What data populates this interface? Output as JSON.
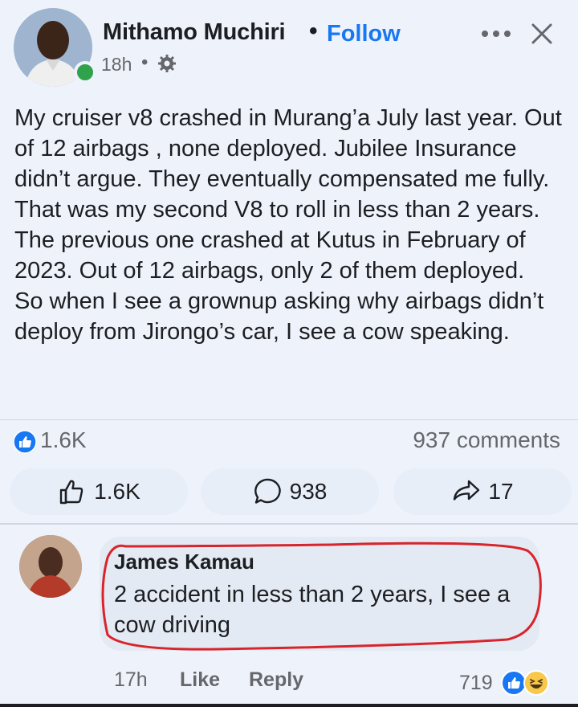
{
  "post": {
    "author": "Mithamo Muchiri",
    "separator": "•",
    "follow_label": "Follow",
    "time": "18h",
    "time_separator": "•",
    "text": "My cruiser v8 crashed in Murang’a July last year. Out of 12 airbags , none deployed. Jubilee Insurance didn’t argue. They eventually compensated me fully. That was my second V8 to roll in less than 2 years. The previous one crashed at Kutus in February of 2023. Out of 12 airbags, only 2 of them deployed.\nSo when I see a grownup asking why airbags didn’t deploy from Jirongo’s car, I see a cow speaking.",
    "reactions_count": "1.6K",
    "comments_summary": "937 comments"
  },
  "actions": {
    "like_count": "1.6K",
    "comment_count": "938",
    "share_count": "17"
  },
  "comment": {
    "author": "James Kamau",
    "text": "2 accident in less than 2 years, I see a cow driving",
    "time": "17h",
    "like_label": "Like",
    "reply_label": "Reply",
    "reactions_count": "719"
  },
  "icons": {
    "header_more": "more-dots-icon",
    "header_close": "close-icon",
    "privacy": "settings-gear-icon",
    "like_badge": "like-reaction-icon",
    "like_button": "thumbs-up-icon",
    "comment_button": "comment-bubble-icon",
    "share_button": "share-arrow-icon",
    "haha_reaction": "haha-reaction-icon"
  },
  "colors": {
    "accent": "#1877f2",
    "online": "#31a24c",
    "highlight_annotation": "#d8242c"
  }
}
